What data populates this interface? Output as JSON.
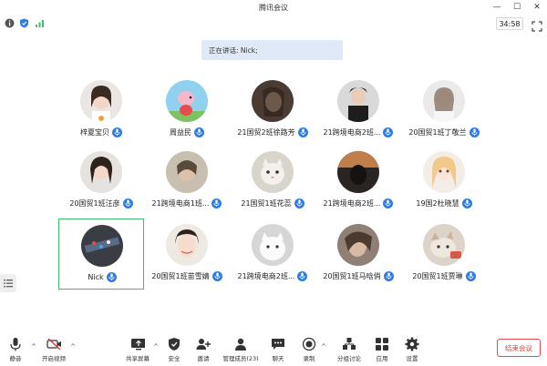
{
  "window": {
    "title": "腾讯会议"
  },
  "meeting": {
    "timer": "34:58",
    "speaking_text": "正在讲话: Nick;"
  },
  "participants": [
    {
      "name": "梓夏宝贝"
    },
    {
      "name": "周益民"
    },
    {
      "name": "21国贸2班徐路芳"
    },
    {
      "name": "21跨境电商2班..."
    },
    {
      "name": "20国贸1班丁敬兰"
    },
    {
      "name": "20国贸1班汪彦"
    },
    {
      "name": "21跨境电商1班..."
    },
    {
      "name": "21国贸1班花蕊"
    },
    {
      "name": "21跨境电商2班..."
    },
    {
      "name": "19国2杜晓慧"
    },
    {
      "name": "Nick"
    },
    {
      "name": "20国贸1班苗雪婧"
    },
    {
      "name": "21跨境电商2班..."
    },
    {
      "name": "20国贸1班马晗俏"
    },
    {
      "name": "20国贸1班贾琳"
    }
  ],
  "toolbar": {
    "mute": "静音",
    "video": "开启视频",
    "share": "共享屏幕",
    "security": "安全",
    "invite": "邀请",
    "members": "管理成员(23)",
    "chat": "聊天",
    "record": "录制",
    "breakout": "分组讨论",
    "apps": "应用",
    "settings": "设置",
    "end": "结束会议"
  },
  "colors": {
    "mic": "#2f7ce8",
    "active_border": "#3bbf6a",
    "end": "#e03a3a",
    "speaking_bg": "#dfe9f7"
  }
}
